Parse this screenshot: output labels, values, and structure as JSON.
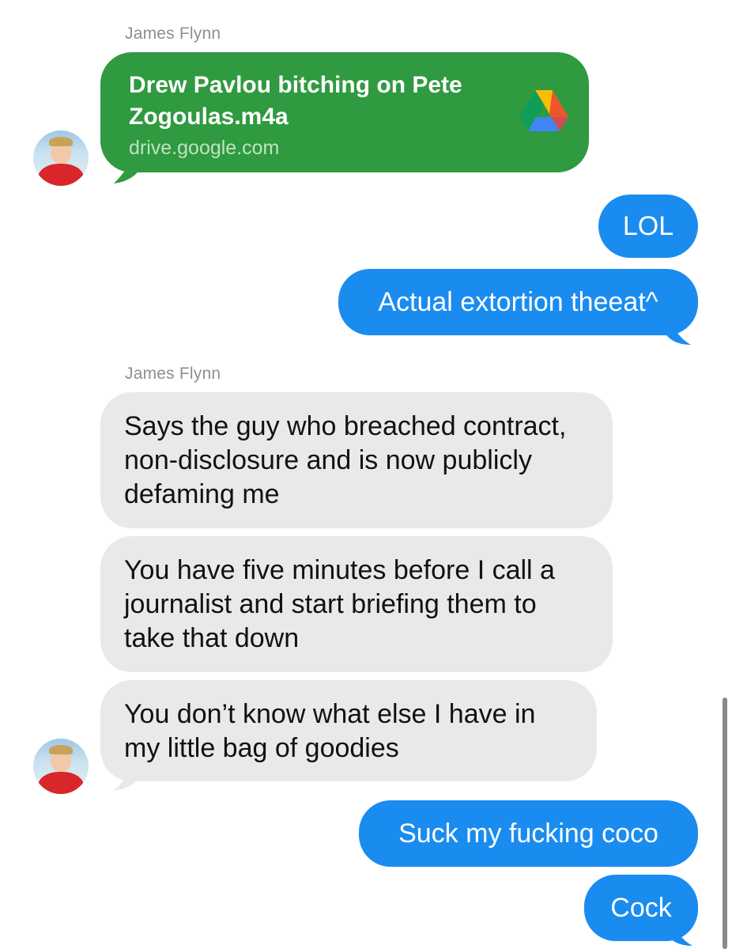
{
  "conversation": {
    "sender_name": "James Flynn",
    "messages": [
      {
        "direction": "incoming",
        "type": "link",
        "title": "Drew Pavlou bitching on Pete Zogoulas.m4a",
        "domain": "drive.google.com",
        "icon": "google-drive-icon"
      },
      {
        "direction": "outgoing",
        "text": "LOL"
      },
      {
        "direction": "outgoing",
        "text": "Actual extortion theeat^"
      },
      {
        "direction": "incoming",
        "text": "Says the guy who breached contract, non-disclosure and is now publicly defaming me"
      },
      {
        "direction": "incoming",
        "text": "You have five minutes before I call a journalist and start briefing them to take that down"
      },
      {
        "direction": "incoming",
        "text": "You don’t know what else I have in my little bag of goodies"
      },
      {
        "direction": "outgoing",
        "text": "Suck my fucking coco"
      },
      {
        "direction": "outgoing",
        "text": "Cock"
      }
    ]
  },
  "colors": {
    "incoming_bubble": "#e9e9eb",
    "outgoing_bubble": "#1a8cf0",
    "link_bubble": "#2f9a3f",
    "sender_name": "#8e8e93"
  }
}
